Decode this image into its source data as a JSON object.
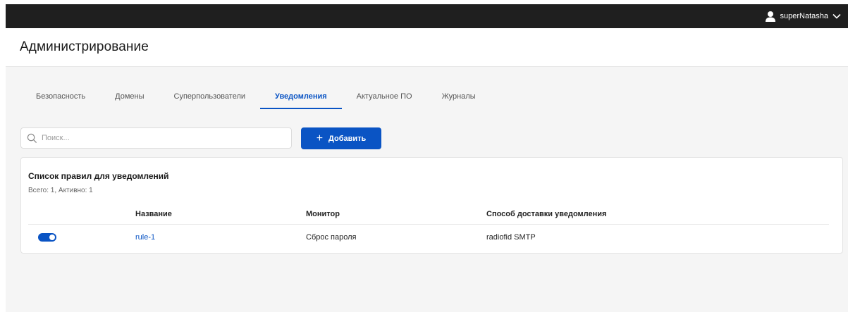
{
  "topbar": {
    "username": "superNatasha",
    "user_icon": "user-icon",
    "dropdown_icon": "chevron-down-icon"
  },
  "header": {
    "title": "Администрирование"
  },
  "tabs": [
    {
      "label": "Безопасность",
      "active": false
    },
    {
      "label": "Домены",
      "active": false
    },
    {
      "label": "Суперпользователи",
      "active": false
    },
    {
      "label": "Уведомления",
      "active": true
    },
    {
      "label": "Актуальное ПО",
      "active": false
    },
    {
      "label": "Журналы",
      "active": false
    }
  ],
  "toolbar": {
    "search_placeholder": "Поиск...",
    "search_value": "",
    "search_icon": "search-icon",
    "add_label": "Добавить",
    "add_icon": "plus-icon"
  },
  "rules": {
    "title": "Список правил для уведомлений",
    "summary": "Всего: 1, Активно: 1",
    "columns": [
      "Название",
      "Монитор",
      "Способ доставки уведомления"
    ],
    "rows": [
      {
        "enabled": true,
        "name": "rule-1",
        "monitor": "Сброс пароля",
        "delivery": "radiofid SMTP"
      }
    ]
  },
  "colors": {
    "accent": "#0a54c4",
    "topbar": "#1f1f1f",
    "background": "#f5f5f5"
  }
}
